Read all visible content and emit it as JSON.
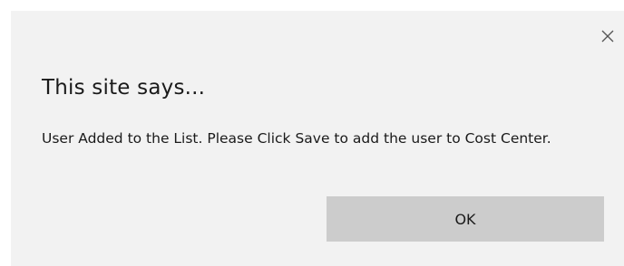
{
  "dialog": {
    "title": "This site says...",
    "message": "User Added to the List. Please Click Save to add the user to Cost Center.",
    "close_icon": "close-icon",
    "ok_label": "OK"
  },
  "colors": {
    "dialog_background": "#f2f2f2",
    "button_background": "#cccccc",
    "text": "#1a1a1a"
  }
}
